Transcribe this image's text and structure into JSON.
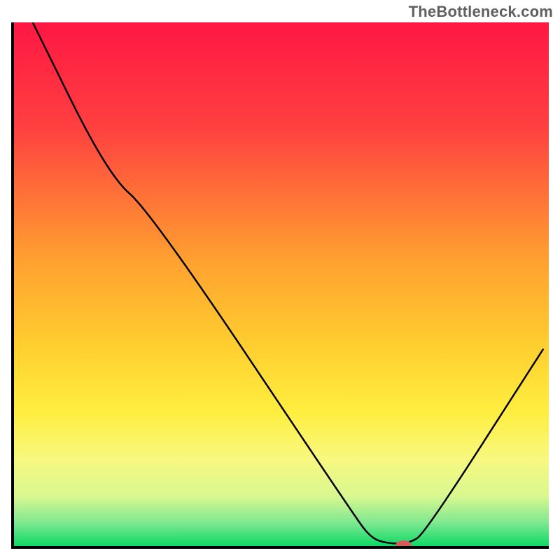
{
  "watermark": "TheBottleneck.com",
  "chart_data": {
    "type": "line",
    "title": "",
    "xlabel": "",
    "ylabel": "",
    "xlim": [
      0,
      100
    ],
    "ylim": [
      0,
      100
    ],
    "gradient_stops": [
      {
        "offset": 0,
        "color": "#ff1744"
      },
      {
        "offset": 20,
        "color": "#ff4040"
      },
      {
        "offset": 45,
        "color": "#ffa030"
      },
      {
        "offset": 62,
        "color": "#ffd030"
      },
      {
        "offset": 74,
        "color": "#ffee40"
      },
      {
        "offset": 83,
        "color": "#f8f880"
      },
      {
        "offset": 90,
        "color": "#d8f890"
      },
      {
        "offset": 95,
        "color": "#80e890"
      },
      {
        "offset": 100,
        "color": "#00d860"
      }
    ],
    "series": [
      {
        "name": "bottleneck-curve",
        "color": "#000000",
        "width": 2.5,
        "points": [
          {
            "x": 4,
            "y": 100
          },
          {
            "x": 18,
            "y": 71
          },
          {
            "x": 26,
            "y": 64
          },
          {
            "x": 64,
            "y": 6
          },
          {
            "x": 67,
            "y": 2
          },
          {
            "x": 70,
            "y": 1
          },
          {
            "x": 74,
            "y": 1
          },
          {
            "x": 77,
            "y": 3
          },
          {
            "x": 99,
            "y": 38
          }
        ]
      }
    ],
    "marker": {
      "name": "optimal-point",
      "x": 73,
      "y": 0.8,
      "color": "#d85a5a",
      "rx": 11,
      "ry": 6
    }
  }
}
